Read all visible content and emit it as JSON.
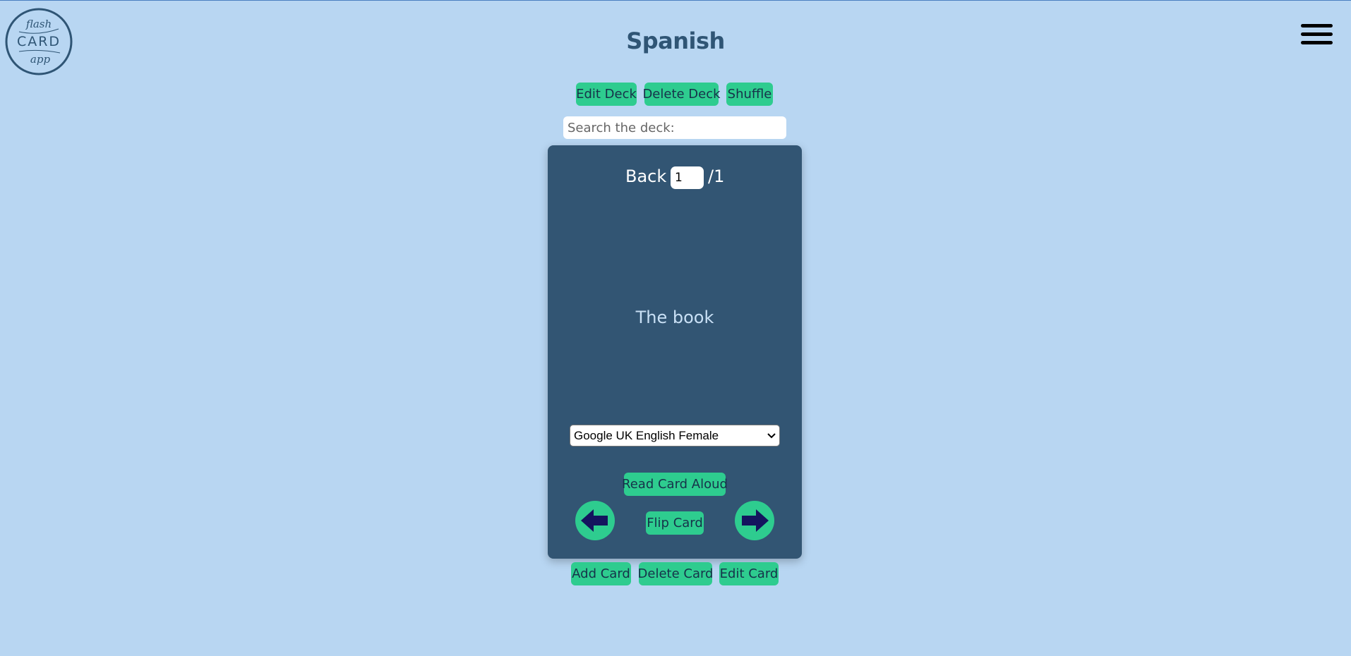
{
  "logo": {
    "line1": "flash",
    "line2": "CARD",
    "line3": "app"
  },
  "header": {
    "title": "Spanish",
    "menu_icon": "hamburger-menu-icon"
  },
  "deck_actions": {
    "edit": "Edit Deck",
    "delete": "Delete Deck",
    "shuffle": "Shuffle"
  },
  "search": {
    "placeholder": "Search the deck:",
    "value": ""
  },
  "card": {
    "side": "Back",
    "current": "1",
    "total": "/1",
    "text": "The book",
    "voice": "Google UK English Female",
    "read_aloud": "Read Card Aloud",
    "flip": "Flip Card",
    "prev_icon": "arrow-left-icon",
    "next_icon": "arrow-right-icon"
  },
  "card_actions": {
    "add": "Add Card",
    "delete": "Delete Card",
    "edit": "Edit Card"
  },
  "colors": {
    "background": "#b8d6f2",
    "card": "#325573",
    "accent": "#2ecc8f",
    "arrow": "#14145e"
  }
}
